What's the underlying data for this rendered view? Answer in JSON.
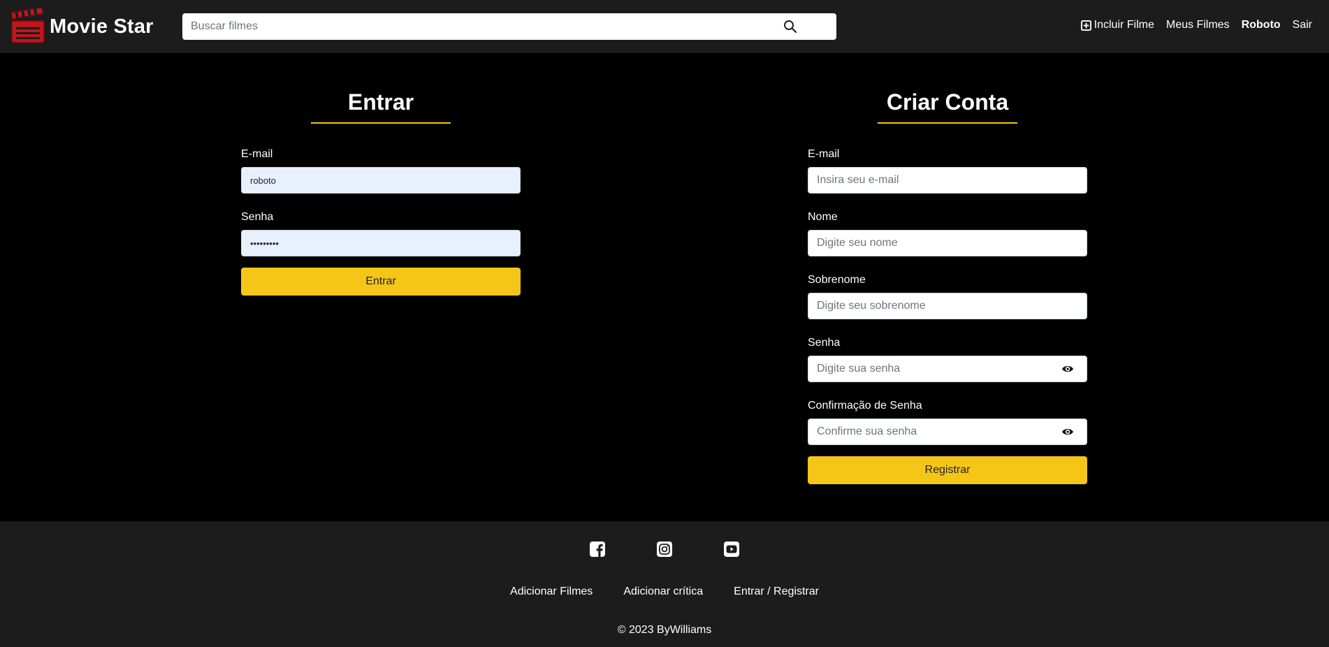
{
  "header": {
    "brand": "Movie Star",
    "logo_icon": "clapperboard-icon",
    "search_placeholder": "Buscar filmes",
    "search_icon": "search-icon",
    "nav": {
      "add_movie": "Incluir Filme",
      "my_movies": "Meus Filmes",
      "user": "Roboto",
      "logout": "Sair"
    }
  },
  "login": {
    "title": "Entrar",
    "email_label": "E-mail",
    "email_value": "roboto",
    "password_label": "Senha",
    "password_value": "•••••••••",
    "submit": "Entrar"
  },
  "register": {
    "title": "Criar Conta",
    "email_label": "E-mail",
    "email_placeholder": "Insira seu e-mail",
    "name_label": "Nome",
    "name_placeholder": "Digite seu nome",
    "lastname_label": "Sobrenome",
    "lastname_placeholder": "Digite seu sobrenome",
    "password_label": "Senha",
    "password_placeholder": "Digite sua senha",
    "confirm_label": "Confirmação de Senha",
    "confirm_placeholder": "Confirme sua senha",
    "submit": "Registrar"
  },
  "footer": {
    "social": [
      "facebook-icon",
      "instagram-icon",
      "youtube-icon"
    ],
    "links": [
      "Adicionar Filmes",
      "Adicionar crítica",
      "Entrar / Registrar"
    ],
    "copyright": "© 2023 ByWilliams"
  },
  "colors": {
    "accent": "#f5c518",
    "header_bg": "#1c1c1c",
    "body_bg": "#000000",
    "logo_red": "#c0161c"
  }
}
